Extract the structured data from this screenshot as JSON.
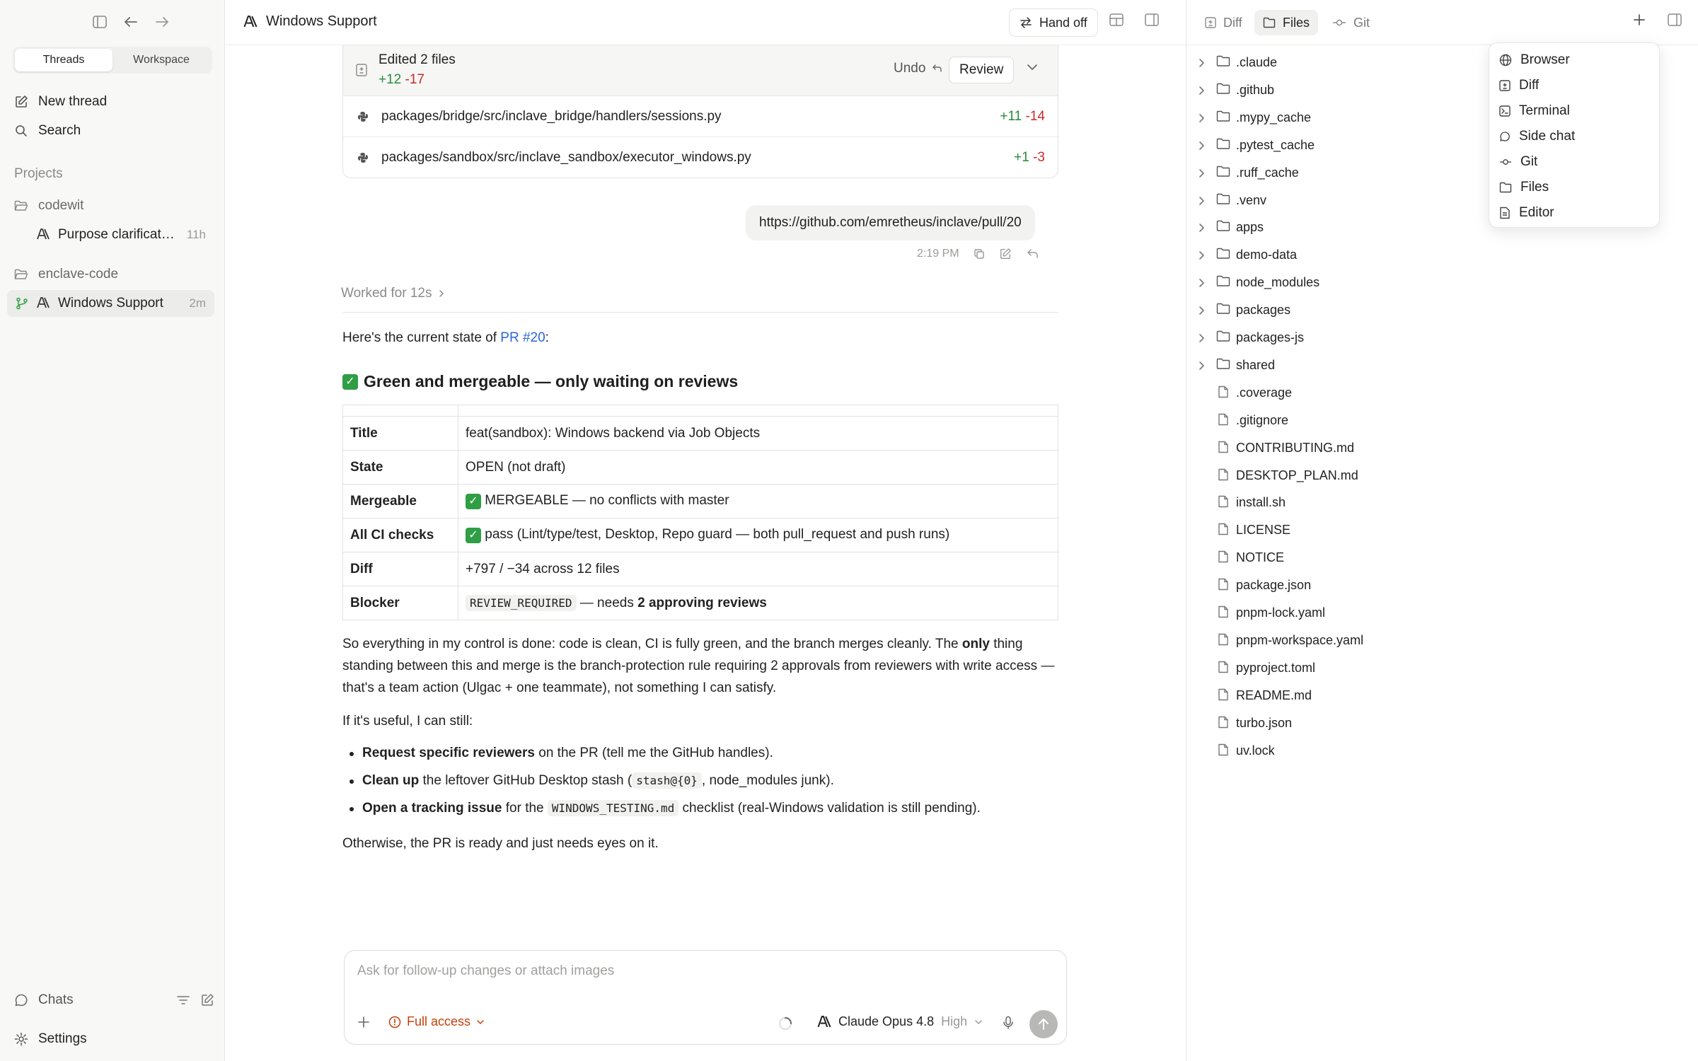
{
  "sidebar": {
    "tabs": [
      "Threads",
      "Workspace"
    ],
    "new_thread": "New thread",
    "search": "Search",
    "projects_label": "Projects",
    "projects": [
      {
        "name": "codewit",
        "threads": [
          {
            "title": "Purpose clarificat…",
            "time": "11h"
          }
        ]
      },
      {
        "name": "enclave-code",
        "threads": [
          {
            "title": "Windows Support",
            "time": "2m"
          }
        ]
      }
    ],
    "chats": "Chats",
    "settings": "Settings"
  },
  "header": {
    "title": "Windows Support",
    "handoff": "Hand off"
  },
  "edits": {
    "label": "Edited 2 files",
    "added": "+12",
    "removed": "-17",
    "undo": "Undo",
    "review": "Review",
    "files": [
      {
        "path": "packages/bridge/src/inclave_bridge/handlers/sessions.py",
        "added": "+11",
        "removed": "-14"
      },
      {
        "path": "packages/sandbox/src/inclave_sandbox/executor_windows.py",
        "added": "+1",
        "removed": "-3"
      }
    ]
  },
  "user_message": {
    "text": "https://github.com/emretheus/inclave/pull/20",
    "time": "2:19 PM"
  },
  "worked": "Worked for 12s",
  "response": {
    "intro_before": "Here's the current state of ",
    "intro_link": "PR #20",
    "intro_after": ":",
    "heading": "Green and mergeable — only waiting on reviews",
    "table": [
      {
        "key": "Title",
        "value": "feat(sandbox): Windows backend via Job Objects"
      },
      {
        "key": "State",
        "value": "OPEN (not draft)"
      },
      {
        "key": "Mergeable",
        "value": "MERGEABLE — no conflicts with master"
      },
      {
        "key": "All CI checks",
        "value": "pass (Lint/type/test, Desktop, Repo guard — both pull_request and push runs)"
      },
      {
        "key": "Diff",
        "value": "+797 / −34 across 12 files"
      },
      {
        "key": "Blocker",
        "code": "REVIEW_REQUIRED",
        "value": " — needs ",
        "bold": "2 approving reviews"
      }
    ],
    "para1_a": "So everything in my control is done: code is clean, CI is fully green, and the branch merges cleanly. The ",
    "para1_bold": "only",
    "para1_b": " thing standing between this and merge is the branch-protection rule requiring 2 approvals from reviewers with write access — that's a team action (Ulgac + one teammate), not something I can satisfy.",
    "para2": "If it's useful, I can still:",
    "bullets": [
      {
        "bold": "Request specific reviewers",
        "text": " on the PR (tell me the GitHub handles)."
      },
      {
        "bold": "Clean up",
        "text": " the leftover GitHub Desktop stash (",
        "code": "stash@{0}",
        "text2": ", node_modules junk)."
      },
      {
        "bold": "Open a tracking issue",
        "text": " for the ",
        "code": "WINDOWS_TESTING.md",
        "text2": " checklist (real-Windows validation is still pending)."
      }
    ],
    "closing": "Otherwise, the PR is ready and just needs eyes on it."
  },
  "composer": {
    "placeholder": "Ask for follow-up changes or attach images",
    "access": "Full access",
    "model": "Claude Opus 4.8",
    "effort": "High"
  },
  "right_panel": {
    "tabs": [
      "Diff",
      "Files",
      "Git"
    ],
    "tree": [
      {
        "name": ".claude",
        "type": "folder"
      },
      {
        "name": ".github",
        "type": "folder"
      },
      {
        "name": ".mypy_cache",
        "type": "folder"
      },
      {
        "name": ".pytest_cache",
        "type": "folder"
      },
      {
        "name": ".ruff_cache",
        "type": "folder"
      },
      {
        "name": ".venv",
        "type": "folder"
      },
      {
        "name": "apps",
        "type": "folder"
      },
      {
        "name": "demo-data",
        "type": "folder"
      },
      {
        "name": "node_modules",
        "type": "folder"
      },
      {
        "name": "packages",
        "type": "folder"
      },
      {
        "name": "packages-js",
        "type": "folder"
      },
      {
        "name": "shared",
        "type": "folder"
      },
      {
        "name": ".coverage",
        "type": "file"
      },
      {
        "name": ".gitignore",
        "type": "file"
      },
      {
        "name": "CONTRIBUTING.md",
        "type": "file"
      },
      {
        "name": "DESKTOP_PLAN.md",
        "type": "file"
      },
      {
        "name": "install.sh",
        "type": "file"
      },
      {
        "name": "LICENSE",
        "type": "file"
      },
      {
        "name": "NOTICE",
        "type": "file"
      },
      {
        "name": "package.json",
        "type": "file"
      },
      {
        "name": "pnpm-lock.yaml",
        "type": "file"
      },
      {
        "name": "pnpm-workspace.yaml",
        "type": "file"
      },
      {
        "name": "pyproject.toml",
        "type": "file"
      },
      {
        "name": "README.md",
        "type": "file"
      },
      {
        "name": "turbo.json",
        "type": "file"
      },
      {
        "name": "uv.lock",
        "type": "file"
      }
    ],
    "menu": [
      {
        "label": "Browser",
        "icon": "globe-icon"
      },
      {
        "label": "Diff",
        "icon": "diff-icon"
      },
      {
        "label": "Terminal",
        "icon": "terminal-icon"
      },
      {
        "label": "Side chat",
        "icon": "chat-bubble-icon"
      },
      {
        "label": "Git",
        "icon": "git-commit-icon"
      },
      {
        "label": "Files",
        "icon": "folder-icon"
      },
      {
        "label": "Editor",
        "icon": "document-icon"
      }
    ]
  }
}
